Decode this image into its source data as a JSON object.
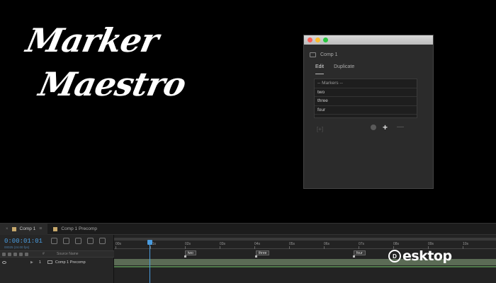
{
  "title": {
    "line1": "Marker",
    "line2": "Maestro"
  },
  "panel": {
    "comp_name": "Comp 1",
    "tabs": [
      {
        "label": "Edit",
        "active": true
      },
      {
        "label": "Duplicate",
        "active": false
      }
    ],
    "markers_header": "-- Markers --",
    "markers": [
      "two",
      "three",
      "four"
    ],
    "toolbar": {
      "bracket": "[+]",
      "plus": "+",
      "minus": "—"
    }
  },
  "timeline": {
    "tabs": [
      {
        "label": "Comp 1",
        "active": true
      },
      {
        "label": "Comp 1 Precomp",
        "active": false
      }
    ],
    "timecode": "0:00:01:01",
    "fps": "00025 (24.00 fps)",
    "columns": {
      "hash": "#",
      "source_name": "Source Name"
    },
    "layer": {
      "number": "1",
      "name": "Comp 1 Precomp"
    },
    "ruler_ticks": [
      "00s",
      "01s",
      "02s",
      "03s",
      "04s",
      "05s",
      "06s",
      "07s",
      "08s",
      "09s",
      "10s"
    ],
    "markers": [
      {
        "label": "two"
      },
      {
        "label": "three"
      },
      {
        "label": "four"
      }
    ]
  },
  "watermark": {
    "text": "esktop",
    "logo": "D"
  },
  "colors": {
    "accent": "#4a9cdf",
    "layer_bar": "#5b6b55",
    "swatch": "#c7a86b"
  }
}
